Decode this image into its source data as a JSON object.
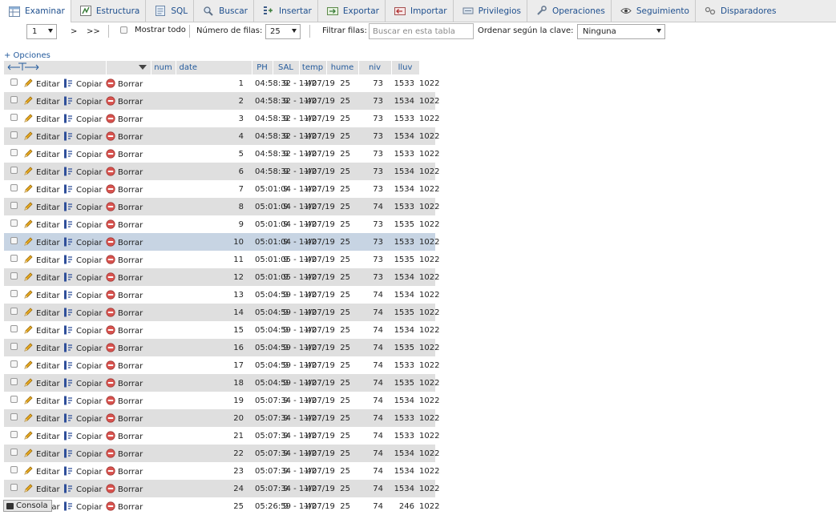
{
  "tabs": [
    {
      "label": "Examinar",
      "icon": "browse-table-icon",
      "active": true
    },
    {
      "label": "Estructura",
      "icon": "structure-icon",
      "active": false
    },
    {
      "label": "SQL",
      "icon": "sql-icon",
      "active": false
    },
    {
      "label": "Buscar",
      "icon": "search-icon",
      "active": false
    },
    {
      "label": "Insertar",
      "icon": "insert-icon",
      "active": false
    },
    {
      "label": "Exportar",
      "icon": "export-icon",
      "active": false
    },
    {
      "label": "Importar",
      "icon": "import-icon",
      "active": false
    },
    {
      "label": "Privilegios",
      "icon": "privileges-icon",
      "active": false
    },
    {
      "label": "Operaciones",
      "icon": "wrench-icon",
      "active": false
    },
    {
      "label": "Seguimiento",
      "icon": "eye-icon",
      "active": false
    },
    {
      "label": "Disparadores",
      "icon": "triggers-icon",
      "active": false
    }
  ],
  "nav": {
    "page_value": "1",
    "next_label": ">",
    "last_label": ">>",
    "show_all_label": "Mostrar todo",
    "rows_label": "Número de filas:",
    "rows_value": "25",
    "filter_label": "Filtrar filas:",
    "filter_placeholder": "Buscar en esta tabla",
    "sort_label": "Ordenar según la clave:",
    "sort_value": "Ninguna"
  },
  "options_label": "+ Opciones",
  "table": {
    "columns": [
      "num",
      "date",
      "PH",
      "SAL",
      "temp",
      "hume",
      "niv",
      "lluv"
    ],
    "actions": {
      "edit": "Editar",
      "copy": "Copiar",
      "delete": "Borrar"
    },
    "rows": [
      {
        "num": "1",
        "date": "04:58:32 - 11/07/19",
        "ph": "9",
        "sal": "-42",
        "temp": "25",
        "hume": "73",
        "niv": "1533",
        "lluv": "1022"
      },
      {
        "num": "2",
        "date": "04:58:32 - 11/07/19",
        "ph": "9",
        "sal": "-42",
        "temp": "25",
        "hume": "73",
        "niv": "1534",
        "lluv": "1022"
      },
      {
        "num": "3",
        "date": "04:58:32 - 11/07/19",
        "ph": "9",
        "sal": "-42",
        "temp": "25",
        "hume": "73",
        "niv": "1533",
        "lluv": "1022"
      },
      {
        "num": "4",
        "date": "04:58:32 - 11/07/19",
        "ph": "9",
        "sal": "-42",
        "temp": "25",
        "hume": "73",
        "niv": "1534",
        "lluv": "1022"
      },
      {
        "num": "5",
        "date": "04:58:32 - 11/07/19",
        "ph": "9",
        "sal": "-42",
        "temp": "25",
        "hume": "73",
        "niv": "1533",
        "lluv": "1022"
      },
      {
        "num": "6",
        "date": "04:58:32 - 11/07/19",
        "ph": "9",
        "sal": "-42",
        "temp": "25",
        "hume": "73",
        "niv": "1534",
        "lluv": "1022"
      },
      {
        "num": "7",
        "date": "05:01:04 - 11/07/19",
        "ph": "9",
        "sal": "-42",
        "temp": "25",
        "hume": "73",
        "niv": "1534",
        "lluv": "1022"
      },
      {
        "num": "8",
        "date": "05:01:04 - 11/07/19",
        "ph": "9",
        "sal": "-42",
        "temp": "25",
        "hume": "74",
        "niv": "1533",
        "lluv": "1022"
      },
      {
        "num": "9",
        "date": "05:01:04 - 11/07/19",
        "ph": "9",
        "sal": "-42",
        "temp": "25",
        "hume": "73",
        "niv": "1535",
        "lluv": "1022"
      },
      {
        "num": "10",
        "date": "05:01:04 - 11/07/19",
        "ph": "9",
        "sal": "-42",
        "temp": "25",
        "hume": "73",
        "niv": "1533",
        "lluv": "1022"
      },
      {
        "num": "11",
        "date": "05:01:05 - 11/07/19",
        "ph": "9",
        "sal": "-42",
        "temp": "25",
        "hume": "73",
        "niv": "1535",
        "lluv": "1022"
      },
      {
        "num": "12",
        "date": "05:01:05 - 11/07/19",
        "ph": "9",
        "sal": "-42",
        "temp": "25",
        "hume": "73",
        "niv": "1534",
        "lluv": "1022"
      },
      {
        "num": "13",
        "date": "05:04:59 - 11/07/19",
        "ph": "9",
        "sal": "-42",
        "temp": "25",
        "hume": "74",
        "niv": "1534",
        "lluv": "1022"
      },
      {
        "num": "14",
        "date": "05:04:59 - 11/07/19",
        "ph": "9",
        "sal": "-42",
        "temp": "25",
        "hume": "74",
        "niv": "1535",
        "lluv": "1022"
      },
      {
        "num": "15",
        "date": "05:04:59 - 11/07/19",
        "ph": "9",
        "sal": "-42",
        "temp": "25",
        "hume": "74",
        "niv": "1534",
        "lluv": "1022"
      },
      {
        "num": "16",
        "date": "05:04:59 - 11/07/19",
        "ph": "9",
        "sal": "-42",
        "temp": "25",
        "hume": "74",
        "niv": "1535",
        "lluv": "1022"
      },
      {
        "num": "17",
        "date": "05:04:59 - 11/07/19",
        "ph": "9",
        "sal": "-42",
        "temp": "25",
        "hume": "74",
        "niv": "1533",
        "lluv": "1022"
      },
      {
        "num": "18",
        "date": "05:04:59 - 11/07/19",
        "ph": "9",
        "sal": "-42",
        "temp": "25",
        "hume": "74",
        "niv": "1535",
        "lluv": "1022"
      },
      {
        "num": "19",
        "date": "05:07:34 - 11/07/19",
        "ph": "9",
        "sal": "-42",
        "temp": "25",
        "hume": "74",
        "niv": "1534",
        "lluv": "1022"
      },
      {
        "num": "20",
        "date": "05:07:34 - 11/07/19",
        "ph": "9",
        "sal": "-42",
        "temp": "25",
        "hume": "74",
        "niv": "1533",
        "lluv": "1022"
      },
      {
        "num": "21",
        "date": "05:07:34 - 11/07/19",
        "ph": "9",
        "sal": "-42",
        "temp": "25",
        "hume": "74",
        "niv": "1533",
        "lluv": "1022"
      },
      {
        "num": "22",
        "date": "05:07:34 - 11/07/19",
        "ph": "9",
        "sal": "-42",
        "temp": "25",
        "hume": "74",
        "niv": "1534",
        "lluv": "1022"
      },
      {
        "num": "23",
        "date": "05:07:34 - 11/07/19",
        "ph": "9",
        "sal": "-42",
        "temp": "25",
        "hume": "74",
        "niv": "1534",
        "lluv": "1022"
      },
      {
        "num": "24",
        "date": "05:07:34 - 11/07/19",
        "ph": "9",
        "sal": "-42",
        "temp": "25",
        "hume": "74",
        "niv": "1534",
        "lluv": "1022"
      },
      {
        "num": "25",
        "date": "05:26:59 - 11/07/19",
        "ph": "9",
        "sal": "-42",
        "temp": "25",
        "hume": "74",
        "niv": "246",
        "lluv": "1022"
      }
    ],
    "highlighted_row": 10
  },
  "console_label": "Consola",
  "colors": {
    "link": "#235a9c",
    "row_alt": "#dfdfdf",
    "row_highlight": "#c7d4e3",
    "header_bg": "#e2e2e2"
  }
}
